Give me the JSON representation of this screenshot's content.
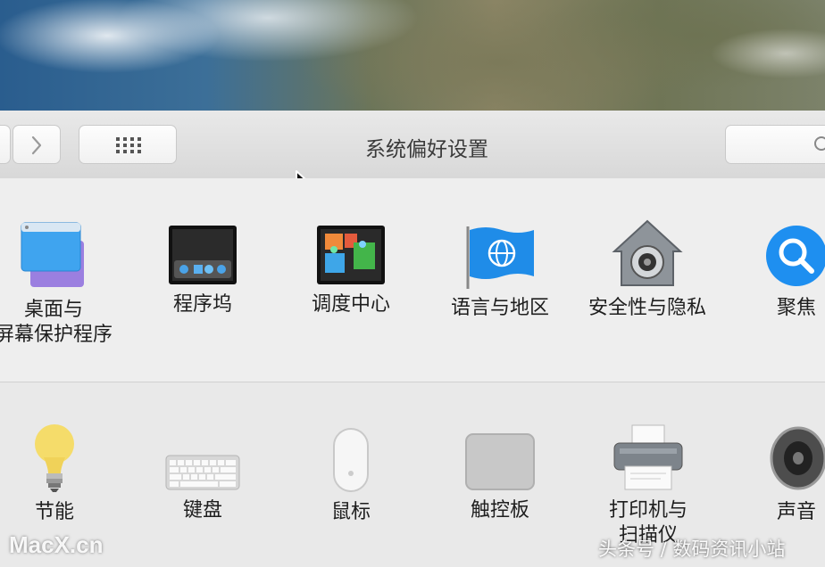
{
  "window": {
    "title": "系统偏好设置"
  },
  "toolbar": {
    "back_icon": "chevron-left-icon",
    "forward_icon": "chevron-right-icon",
    "show_all_icon": "grid-icon",
    "search_icon": "search-icon"
  },
  "panes_row1": [
    {
      "label_line1": "桌面与",
      "label_line2": "屏幕保护程序",
      "icon": "desktop-screensaver-icon"
    },
    {
      "label_line1": "程序坞",
      "icon": "dock-icon"
    },
    {
      "label_line1": "调度中心",
      "icon": "mission-control-icon"
    },
    {
      "label_line1": "语言与地区",
      "icon": "language-region-icon"
    },
    {
      "label_line1": "安全性与隐私",
      "icon": "security-privacy-icon"
    },
    {
      "label_line1": "聚焦",
      "icon": "spotlight-icon"
    }
  ],
  "panes_row2": [
    {
      "label_line1": "节能",
      "icon": "energy-saver-icon"
    },
    {
      "label_line1": "键盘",
      "icon": "keyboard-icon"
    },
    {
      "label_line1": "鼠标",
      "icon": "mouse-icon"
    },
    {
      "label_line1": "触控板",
      "icon": "trackpad-icon"
    },
    {
      "label_line1": "打印机与",
      "label_line2": "扫描仪",
      "icon": "printer-scanner-icon"
    },
    {
      "label_line1": "声音",
      "icon": "sound-icon"
    }
  ],
  "watermarks": {
    "left": "MacX.cn",
    "right": "头条号 / 数码资讯小站"
  },
  "colors": {
    "window_bg": "#ececec",
    "accent_blue": "#1e8ff0"
  }
}
